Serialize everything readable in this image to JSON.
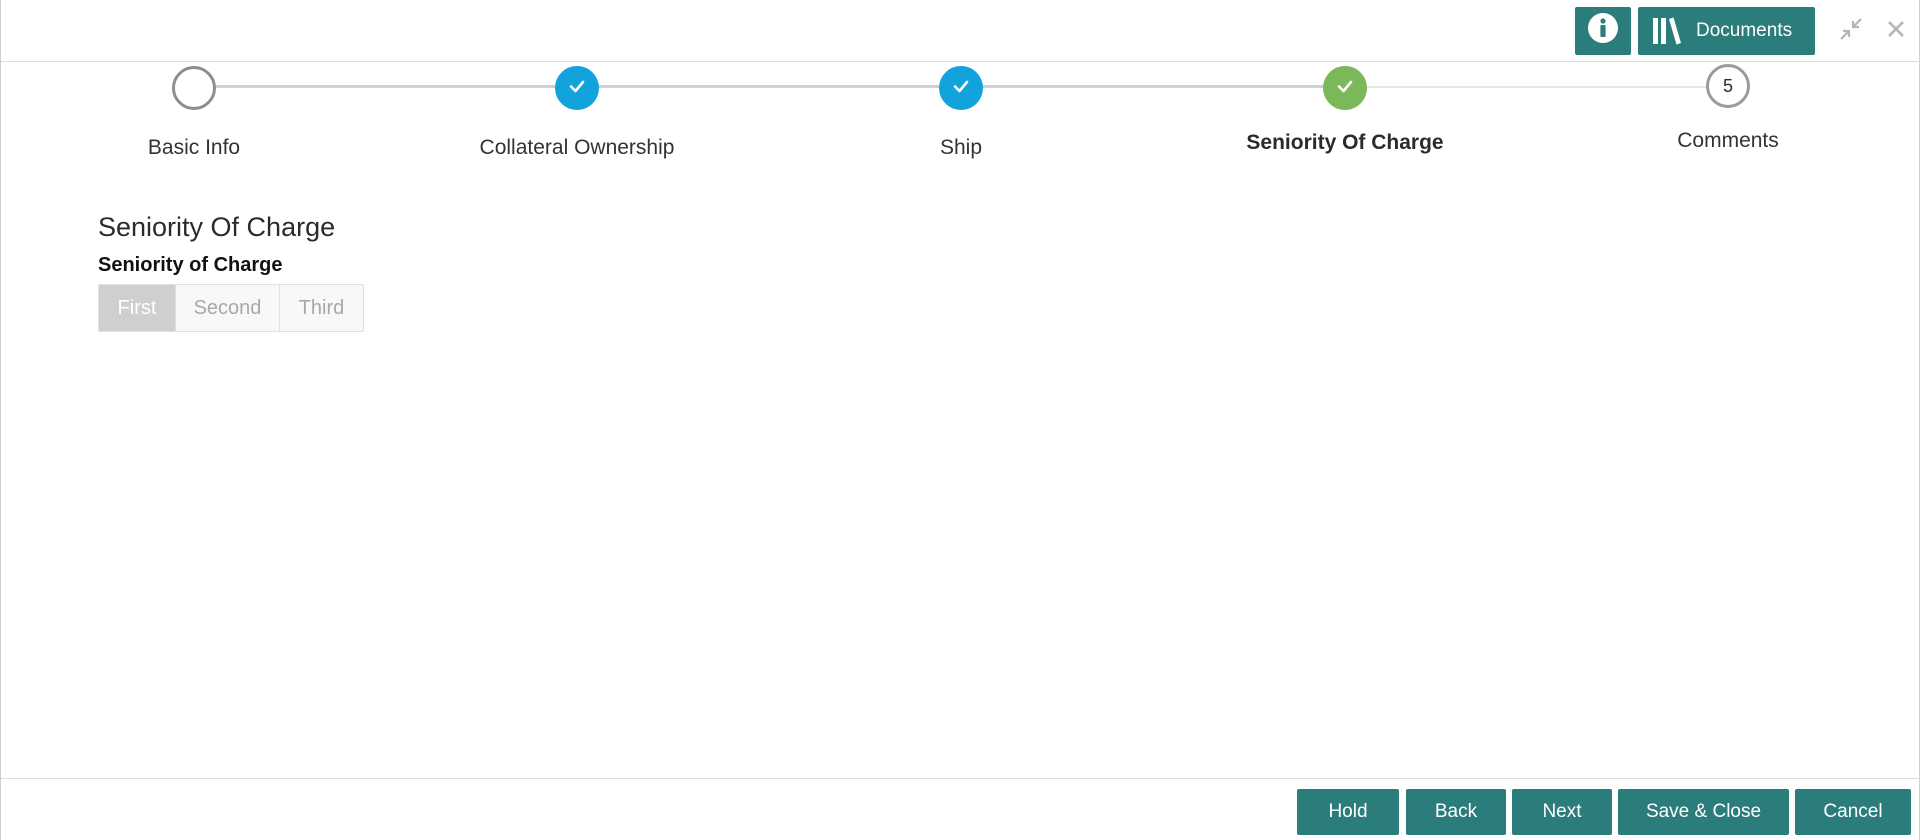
{
  "header": {
    "info_icon": "info-icon",
    "documents_icon": "library-icon",
    "documents_label": "Documents",
    "minimize_icon": "minimize-icon",
    "close_icon": "close-icon",
    "accent_color": "#2b7d7b"
  },
  "stepper": {
    "steps": [
      {
        "label": "Basic Info",
        "state": "incomplete"
      },
      {
        "label": "Collateral Ownership",
        "state": "completed"
      },
      {
        "label": "Ship",
        "state": "completed"
      },
      {
        "label": "Seniority Of Charge",
        "state": "current"
      },
      {
        "label": "Comments",
        "state": "pending",
        "number": "5"
      }
    ],
    "completed_color": "#12a3dc",
    "current_color": "#7ab85a"
  },
  "main": {
    "section_title": "Seniority Of Charge",
    "field_label": "Seniority of Charge",
    "options": [
      "First",
      "Second",
      "Third"
    ],
    "selected": "First"
  },
  "footer": {
    "hold_label": "Hold",
    "back_label": "Back",
    "next_label": "Next",
    "save_close_label": "Save & Close",
    "cancel_label": "Cancel"
  }
}
